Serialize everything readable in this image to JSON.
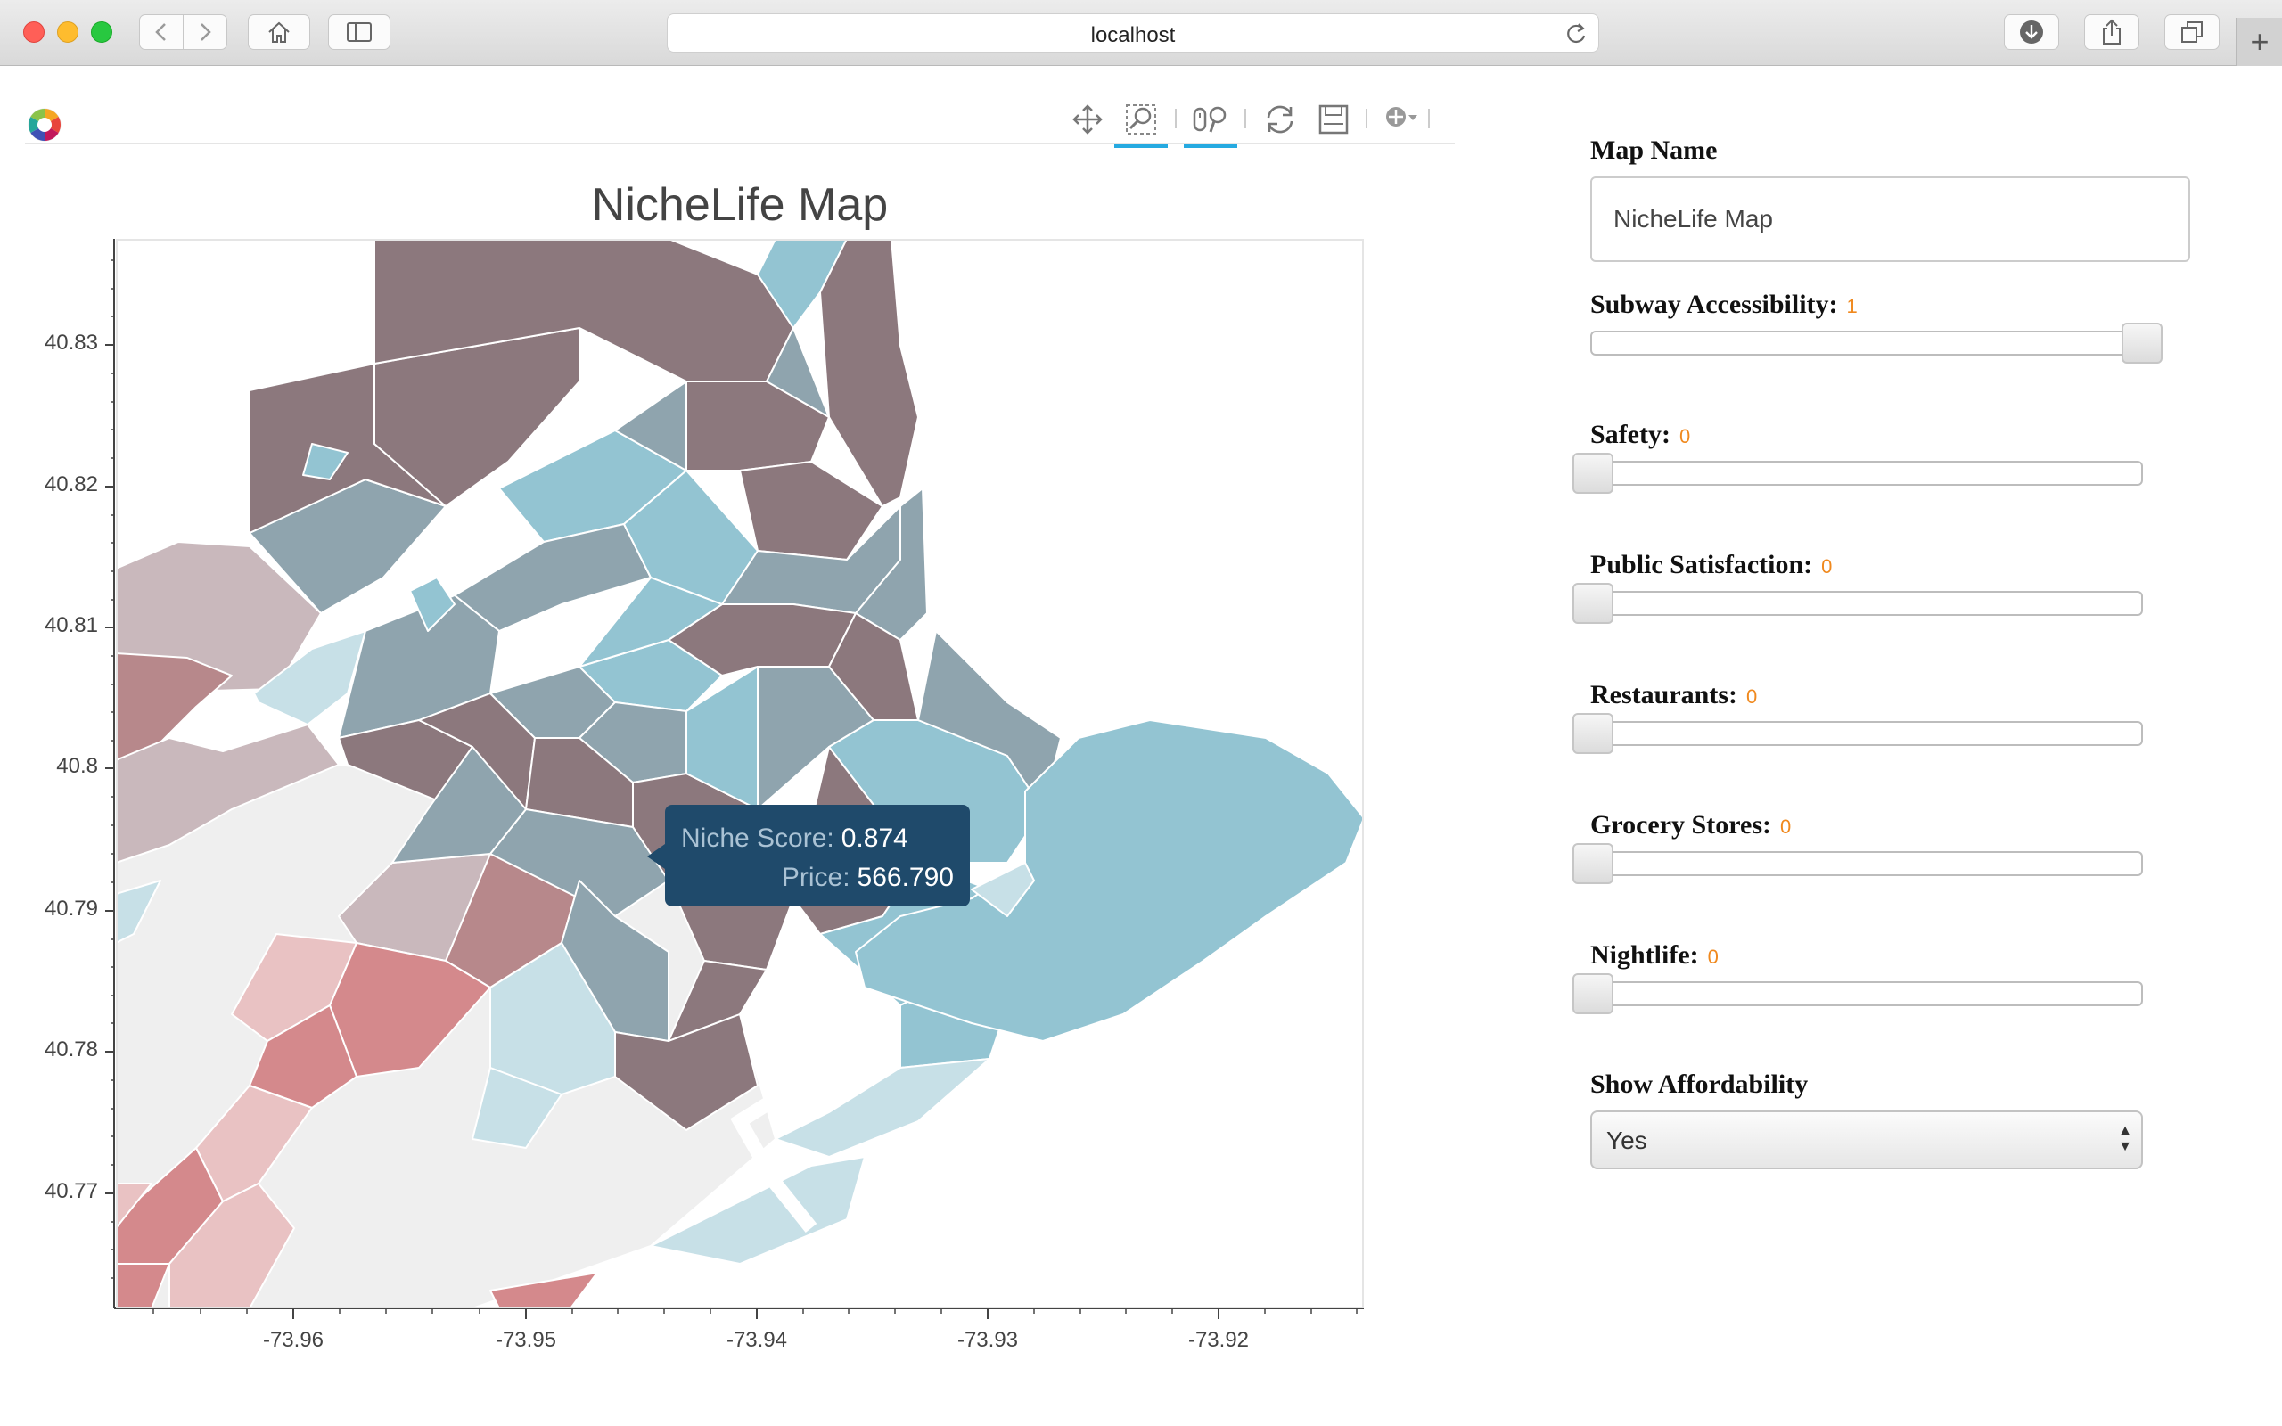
{
  "browser": {
    "url": "localhost"
  },
  "plot": {
    "title": "NicheLife Map",
    "tooltip": {
      "score_label": "Niche Score:",
      "score_value": "0.874",
      "price_label": "Price:",
      "price_value": "566.790"
    }
  },
  "chart_data": {
    "type": "map",
    "title": "NicheLife Map",
    "x_ticks": [
      "-73.96",
      "-73.95",
      "-73.94",
      "-73.93",
      "-73.92"
    ],
    "y_ticks": [
      "40.83",
      "40.82",
      "40.81",
      "40.8",
      "40.79",
      "40.78",
      "40.77"
    ],
    "xlim": [
      -73.9675,
      -73.9137
    ],
    "ylim": [
      40.7625,
      40.8375
    ],
    "colors": {
      "blue": "#93c4d2",
      "slate": "#8fa4ae",
      "mauve": "#8c787d",
      "red": "#d4898c",
      "pink": "#e9c2c3",
      "gray": "#efefef"
    }
  },
  "widgets": {
    "map_name": {
      "label": "Map Name",
      "value": "NicheLife Map"
    },
    "sliders": [
      {
        "label": "Subway Accessibility:",
        "value": "1",
        "level": 1
      },
      {
        "label": "Safety:",
        "value": "0",
        "level": 0
      },
      {
        "label": "Public Satisfaction:",
        "value": "0",
        "level": 0
      },
      {
        "label": "Restaurants:",
        "value": "0",
        "level": 0
      },
      {
        "label": "Grocery Stores:",
        "value": "0",
        "level": 0
      },
      {
        "label": "Nightlife:",
        "value": "0",
        "level": 0
      }
    ],
    "affordability": {
      "label": "Show Affordability",
      "selected": "Yes"
    }
  }
}
